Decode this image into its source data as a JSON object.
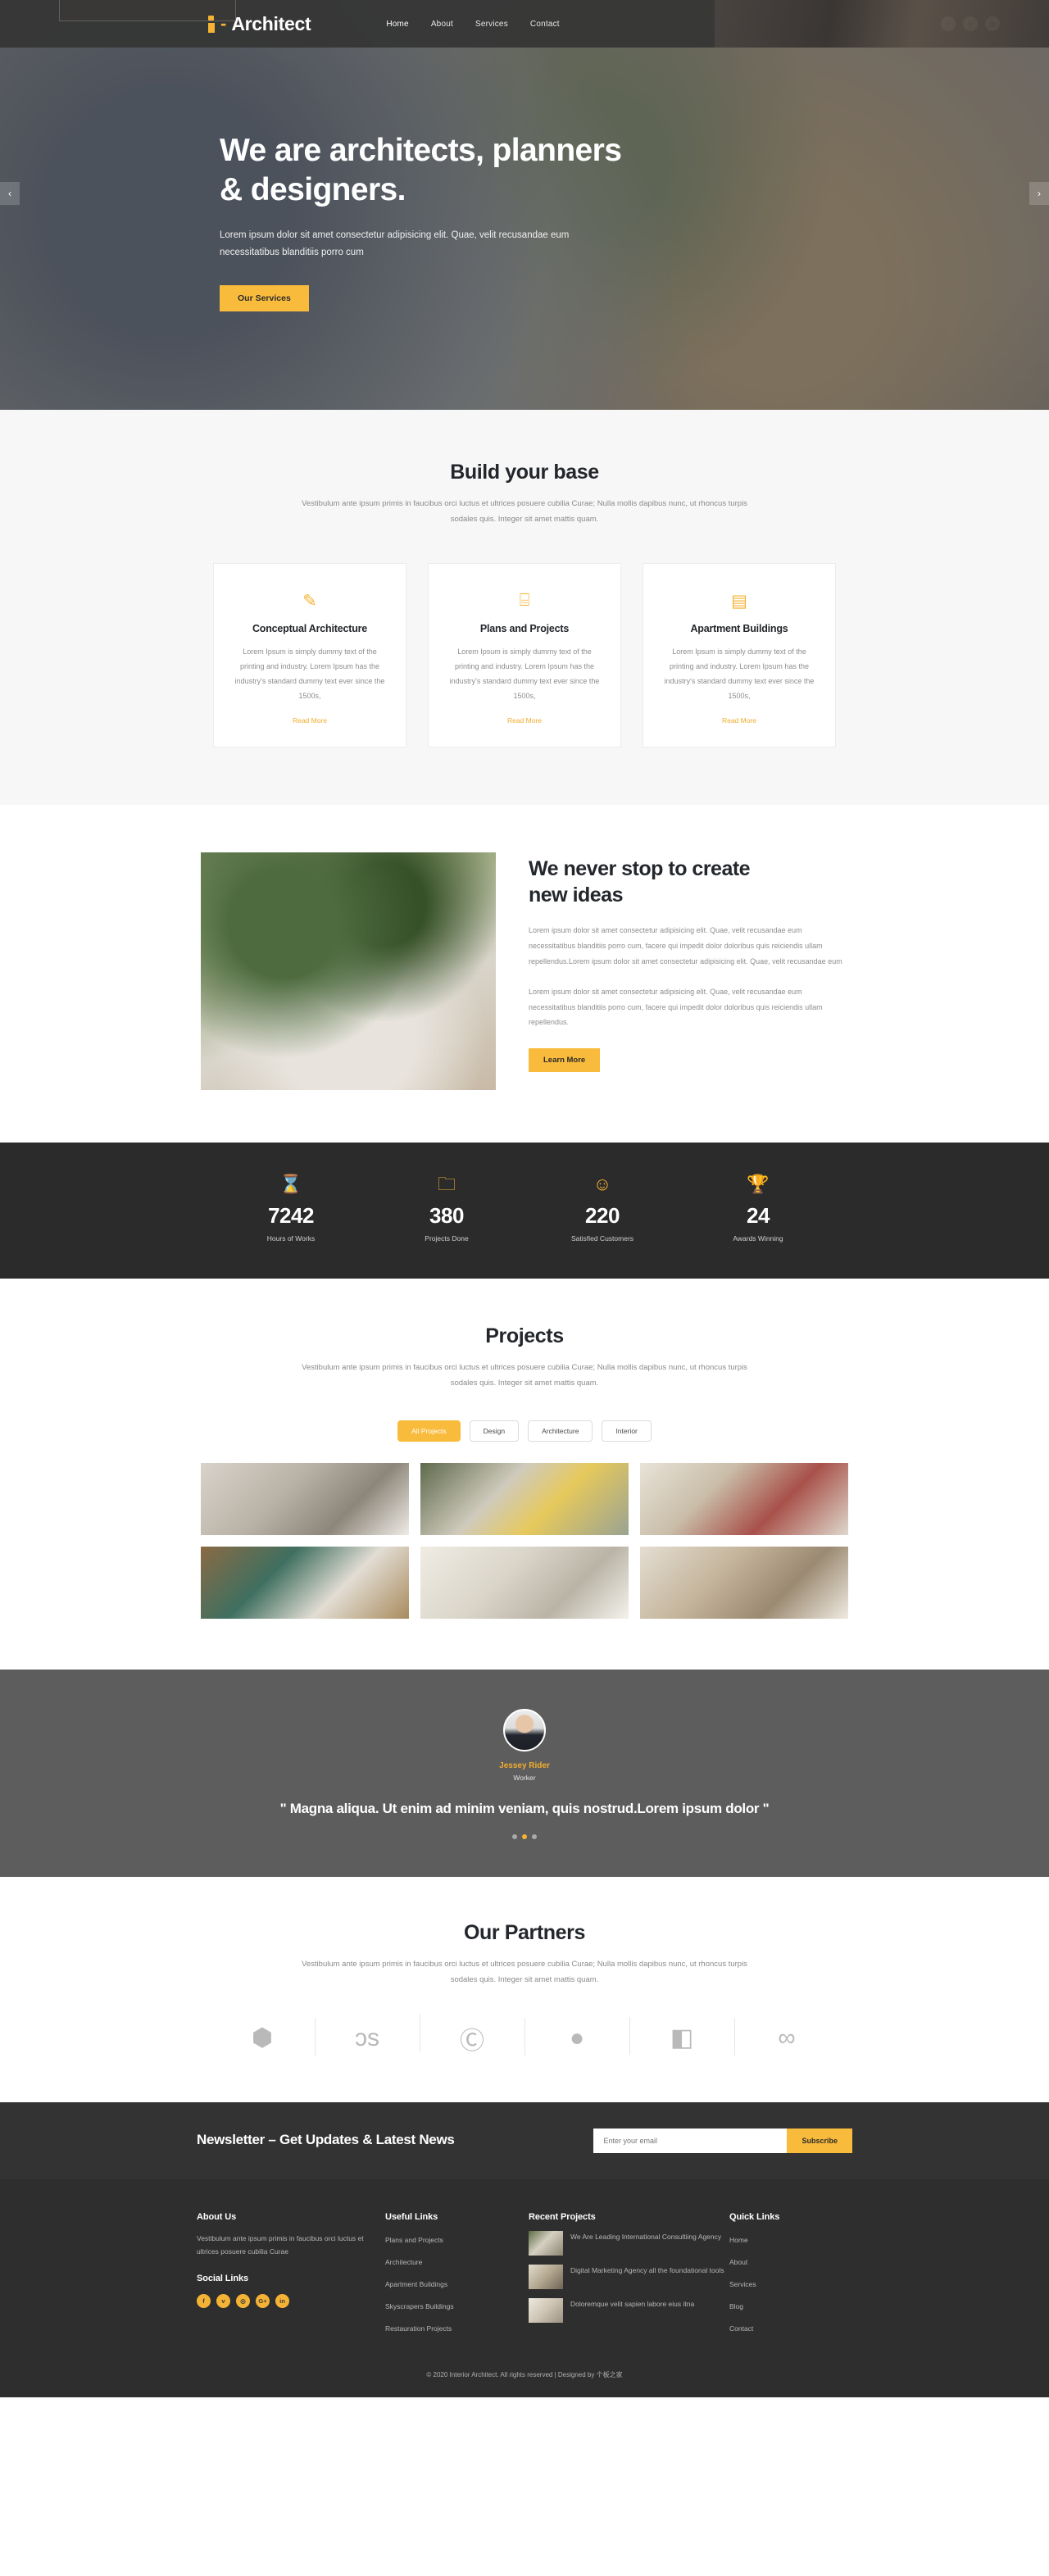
{
  "header": {
    "brand": "Architect",
    "brand_dash": "-",
    "nav": [
      {
        "label": "Home",
        "active": true
      },
      {
        "label": "About",
        "active": false
      },
      {
        "label": "Services",
        "active": false
      },
      {
        "label": "Contact",
        "active": false
      }
    ],
    "social": [
      {
        "name": "facebook-icon",
        "glyph": "f"
      },
      {
        "name": "twitter-icon",
        "glyph": "ᴠ"
      },
      {
        "name": "instagram-icon",
        "glyph": "◎"
      }
    ]
  },
  "hero": {
    "heading_line1": "We are architects, planners",
    "heading_line2": "& designers.",
    "paragraph": "Lorem ipsum dolor sit amet consectetur adipisicing elit. Quae, velit recusandae eum necessitatibus blanditiis porro cum",
    "cta": "Our Services",
    "prev": "‹",
    "next": "›"
  },
  "base": {
    "title": "Build your base",
    "subtitle": "Vestibulum ante ipsum primis in faucibus orci luctus et ultrices posuere cubilia Curae; Nulla mollis dapibus nunc, ut rhoncus turpis sodales quis. Integer sit amet mattis quam.",
    "cards": [
      {
        "icon": "paintbrush-icon",
        "glyph": "✎",
        "title": "Conceptual Architecture",
        "text": "Lorem Ipsum is simply dummy text of the printing and industry. Lorem Ipsum has the industry's standard dummy text ever since the 1500s,",
        "link": "Read More"
      },
      {
        "icon": "blueprint-icon",
        "glyph": "⌸",
        "title": "Plans and Projects",
        "text": "Lorem Ipsum is simply dummy text of the printing and industry. Lorem Ipsum has the industry's standard dummy text ever since the 1500s,",
        "link": "Read More"
      },
      {
        "icon": "building-icon",
        "glyph": "▤",
        "title": "Apartment Buildings",
        "text": "Lorem Ipsum is simply dummy text of the printing and industry. Lorem Ipsum has the industry's standard dummy text ever since the 1500s,",
        "link": "Read More"
      }
    ]
  },
  "ideas": {
    "heading_line1": "We never stop to create",
    "heading_line2": "new ideas",
    "paragraph1": "Lorem ipsum dolor sit amet consectetur adipisicing elit. Quae, velit recusandae eum necessitatibus blanditiis porro cum, facere qui impedit dolor doloribus quis reiciendis ullam repellendus.Lorem ipsum dolor sit amet consectetur adipisicing elit. Quae, velit recusandae eum",
    "paragraph2": "Lorem ipsum dolor sit amet consectetur adipisicing elit. Quae, velit recusandae eum necessitatibus blanditiis porro cum, facere qui impedit dolor doloribus quis reiciendis ullam repellendus.",
    "cta": "Learn More"
  },
  "stats": [
    {
      "icon": "hourglass-icon",
      "glyph": "⌛",
      "value": "7242",
      "label": "Hours of Works"
    },
    {
      "icon": "folder-icon",
      "glyph": "🗀",
      "value": "380",
      "label": "Projects Done"
    },
    {
      "icon": "smiley-icon",
      "glyph": "☺",
      "value": "220",
      "label": "Satisfied Customers"
    },
    {
      "icon": "trophy-icon",
      "glyph": "🏆",
      "value": "24",
      "label": "Awards Winning"
    }
  ],
  "projects": {
    "title": "Projects",
    "subtitle": "Vestibulum ante ipsum primis in faucibus orci luctus et ultrices posuere cubilia Curae; Nulla mollis dapibus nunc, ut rhoncus turpis sodales quis. Integer sit amet mattis quam.",
    "filters": [
      {
        "label": "All Projects",
        "active": true
      },
      {
        "label": "Design",
        "active": false
      },
      {
        "label": "Architecture",
        "active": false
      },
      {
        "label": "Interior",
        "active": false
      }
    ],
    "items": [
      {
        "name": "project-thumb-kitchen"
      },
      {
        "name": "project-thumb-living-room"
      },
      {
        "name": "project-thumb-lounge"
      },
      {
        "name": "project-thumb-bathroom"
      },
      {
        "name": "project-thumb-dining"
      },
      {
        "name": "project-thumb-kitchen-2"
      }
    ]
  },
  "testimonial": {
    "name": "Jessey Rider",
    "role": "Worker",
    "quote": "\" Magna aliqua. Ut enim ad minim veniam, quis nostrud.Lorem ipsum dolor \"",
    "dots": [
      false,
      true,
      false
    ]
  },
  "partners": {
    "title": "Our Partners",
    "subtitle": "Vestibulum ante ipsum primis in faucibus orci luctus et ultrices posuere cubilia Curae; Nulla mollis dapibus nunc, ut rhoncus turpis sodales quis. Integer sit amet mattis quam.",
    "logos": [
      {
        "name": "diamond-logo-icon",
        "glyph": "⬢"
      },
      {
        "name": "lastfm-logo-icon",
        "glyph": "ɔs"
      },
      {
        "name": "c-logo-icon",
        "glyph": "Ⓒ"
      },
      {
        "name": "drupal-logo-icon",
        "glyph": "●"
      },
      {
        "name": "joomla-logo-icon",
        "glyph": "◧"
      },
      {
        "name": "loop-logo-icon",
        "glyph": "∞"
      }
    ]
  },
  "newsletter": {
    "heading": "Newsletter – Get Updates & Latest News",
    "placeholder": "Enter your email",
    "value": "",
    "button": "Subscribe"
  },
  "footer": {
    "about": {
      "title": "About Us",
      "text": "Vestibulum ante ipsum primis in faucibus orci luctus et ultrices posuere cubilia Curae",
      "social_title": "Social Links",
      "social": [
        {
          "name": "facebook-icon",
          "glyph": "f"
        },
        {
          "name": "twitter-icon",
          "glyph": "ᴠ"
        },
        {
          "name": "instagram-icon",
          "glyph": "◎"
        },
        {
          "name": "google-plus-icon",
          "glyph": "G+"
        },
        {
          "name": "linkedin-icon",
          "glyph": "in"
        }
      ]
    },
    "useful": {
      "title": "Useful Links",
      "links": [
        "Plans and Projects",
        "Architecture",
        "Apartment Buildings",
        "Skyscrapers Buildings",
        "Restauration Projects"
      ]
    },
    "recent": {
      "title": "Recent Projects",
      "items": [
        "We Are Leading International Consultiing Agency",
        "Digital Marketing Agency all the foundational tools",
        "Doloremque velit sapien labore eius itna"
      ]
    },
    "quick": {
      "title": "Quick Links",
      "links": [
        "Home",
        "About",
        "Services",
        "Blog",
        "Contact"
      ]
    },
    "copyright": "© 2020 Interior Architect. All rights reserved | Designed by 个板之家"
  }
}
